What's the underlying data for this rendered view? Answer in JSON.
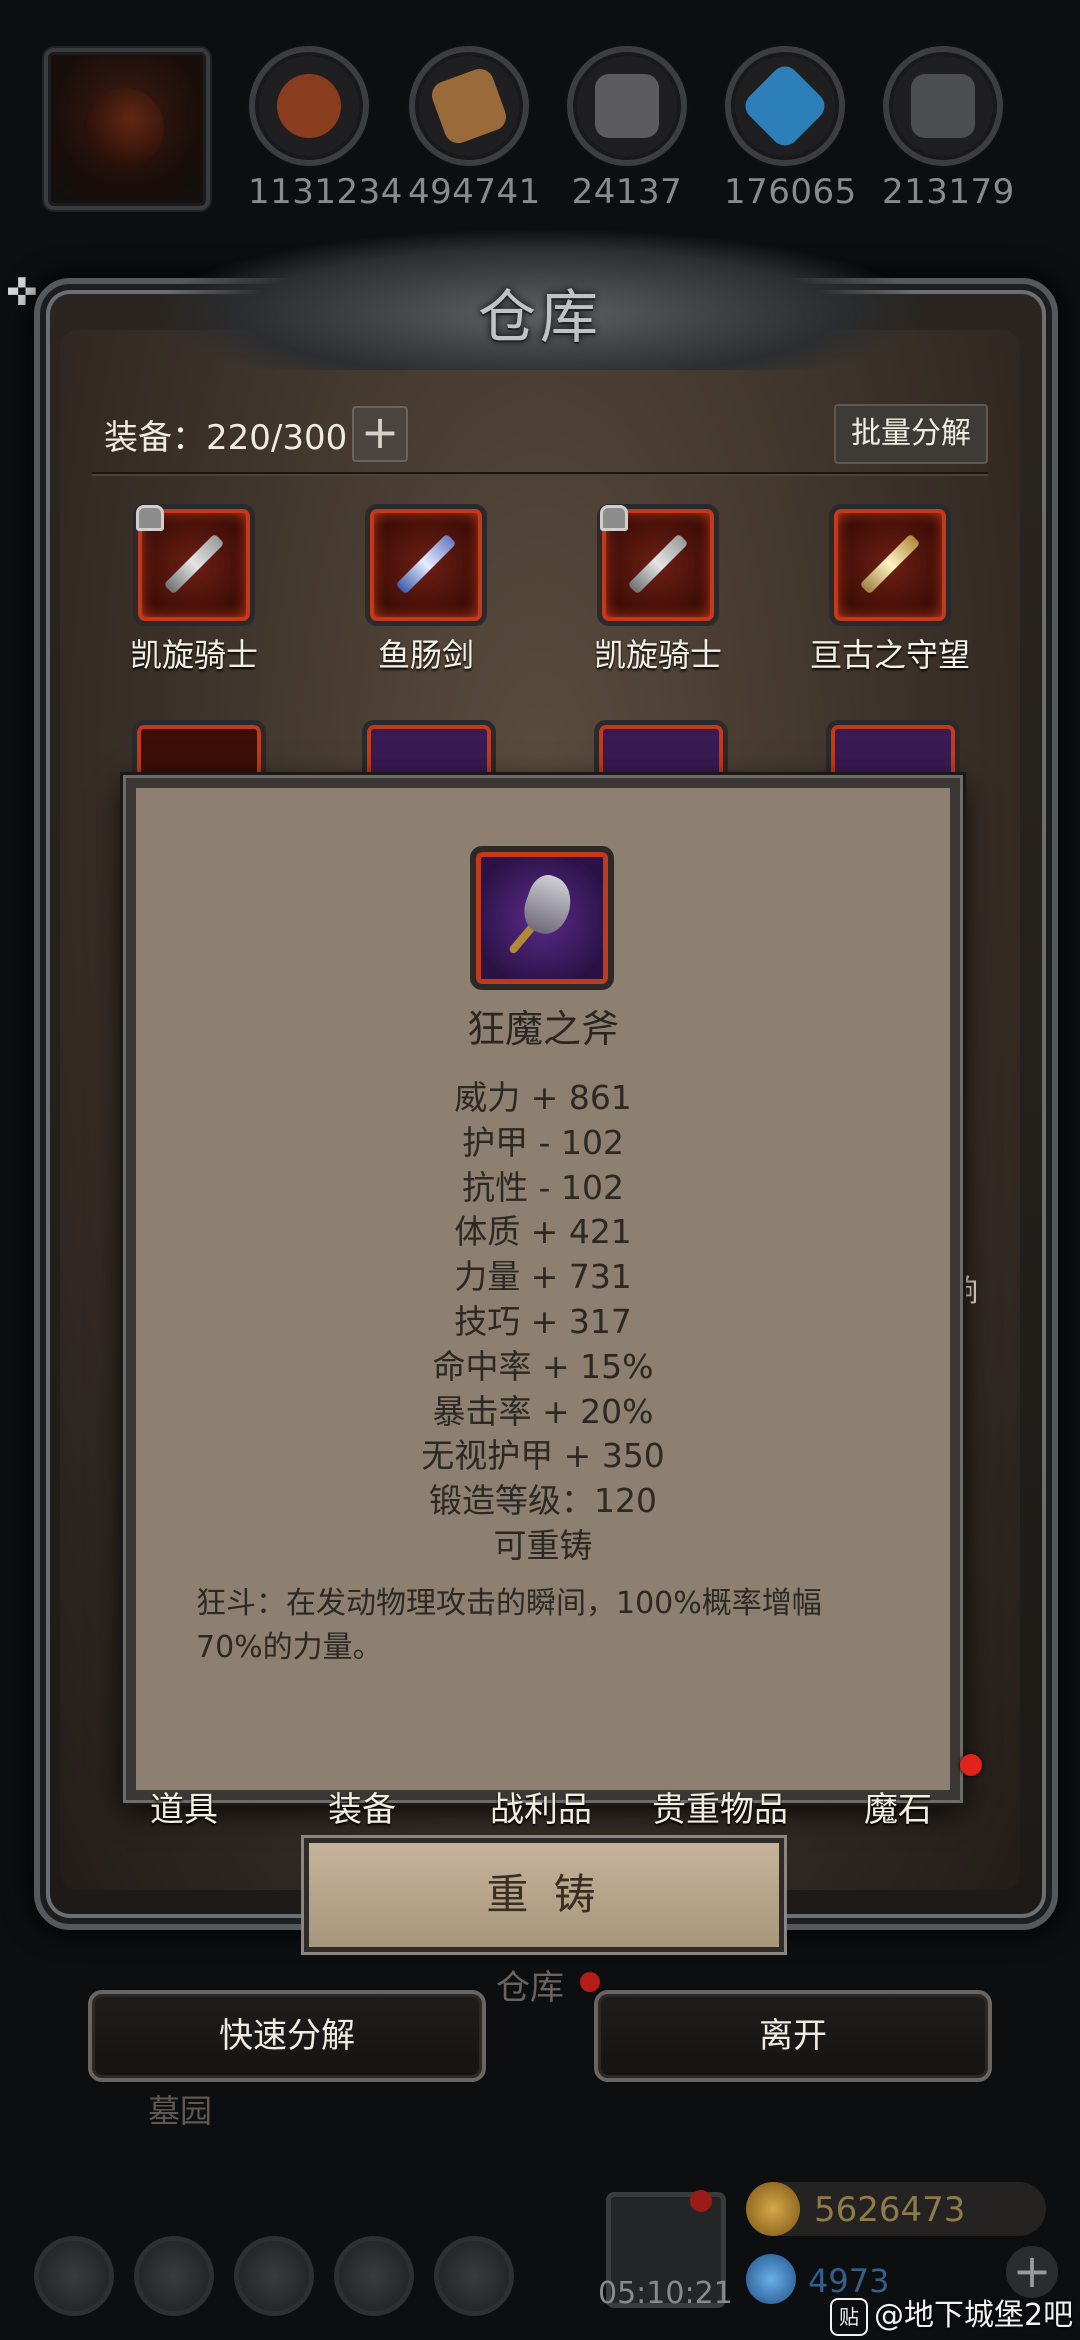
{
  "resources": [
    {
      "icon": "meat-icon",
      "value": "1131234",
      "color": "#8a3d1e"
    },
    {
      "icon": "wood-icon",
      "value": "494741",
      "color": "#9a6a3a"
    },
    {
      "icon": "stone-icon",
      "value": "24137",
      "color": "#5c5c5e"
    },
    {
      "icon": "crystal-icon",
      "value": "176065",
      "color": "#2c7fb8"
    },
    {
      "icon": "iron-icon",
      "value": "213179",
      "color": "#4d4e50"
    }
  ],
  "warehouse": {
    "title": "仓库",
    "capacity_label": "装备：220/300",
    "plus": "+",
    "batch_label": "批量分解",
    "items": [
      {
        "name": "凯旋骑士",
        "locked": true
      },
      {
        "name": "鱼肠剑",
        "locked": false
      },
      {
        "name": "凯旋骑士",
        "locked": true
      },
      {
        "name": "亘古之守望",
        "locked": false
      }
    ],
    "side_glyph": "响"
  },
  "tooltip": {
    "item_name": "狂魔之斧",
    "stats": [
      "威力 + 861",
      "护甲 - 102",
      "抗性 - 102",
      "体质 + 421",
      "力量 + 731",
      "技巧 + 317",
      "命中率 + 15%",
      "暴击率 + 20%",
      "无视护甲 + 350",
      "锻造等级：120",
      "可重铸"
    ],
    "description": "狂斗：在发动物理攻击的瞬间，100%概率增幅70%的力量。"
  },
  "tabs": [
    "道具",
    "装备",
    "战利品",
    "贵重物品",
    "魔石"
  ],
  "reforge_label": "重 铸",
  "warehouse_label": "仓库",
  "actions": {
    "quick_decompose": "快速分解",
    "leave": "离开"
  },
  "cemetery_label": "墓园",
  "hud": {
    "time": "05:10:21",
    "gold": "5626473",
    "gems": "4973",
    "plus": "+"
  },
  "watermark": {
    "badge": "贴",
    "text": "@地下城堡2吧"
  }
}
